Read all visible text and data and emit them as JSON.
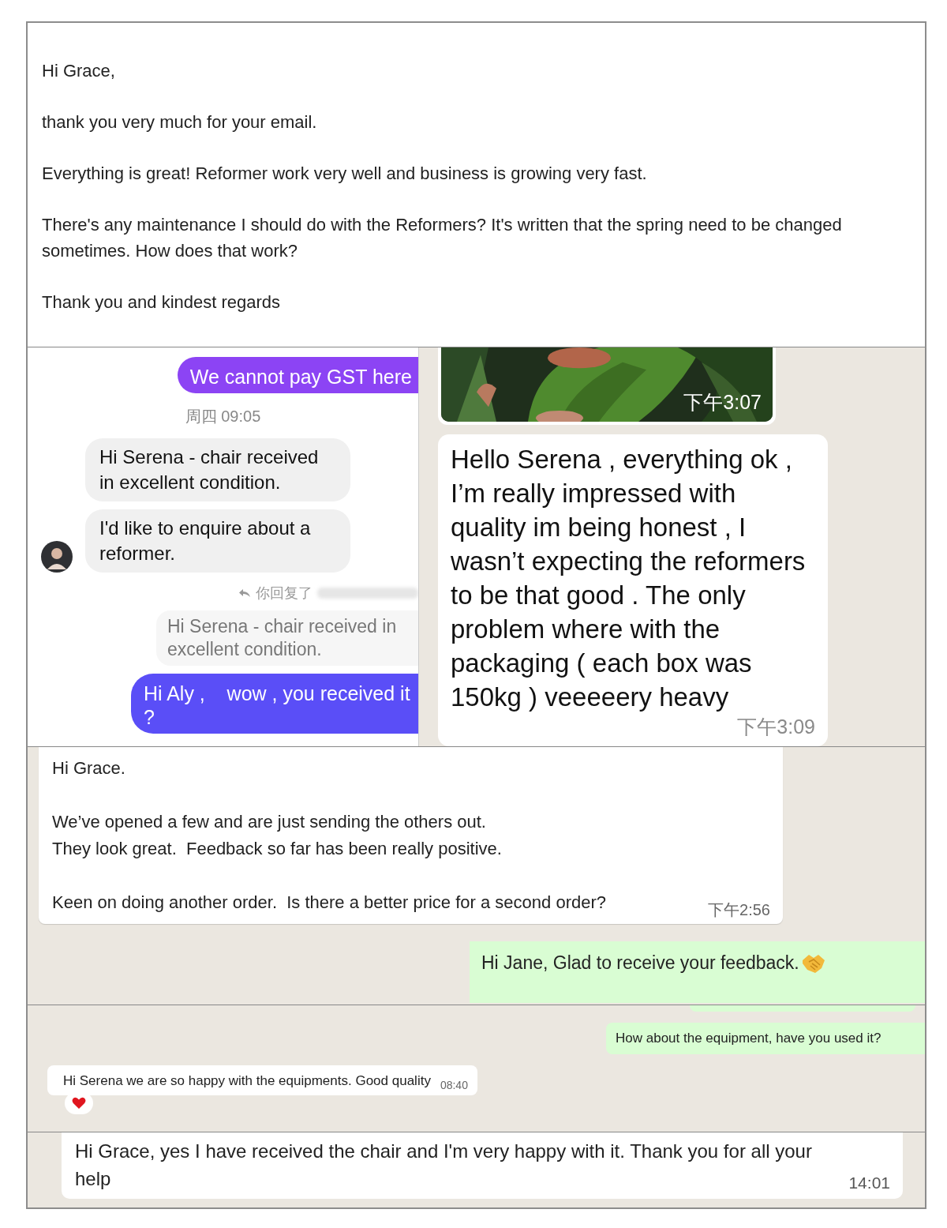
{
  "email": {
    "paragraphs": [
      [
        "Hi Grace,"
      ],
      [
        "thank you very much for your email."
      ],
      [
        "Everything is great! Reformer work very well and business is growing very fast."
      ],
      [
        "There's any maintenance I should do with the Reformers? It's written that the spring need to be changed sometimes. How does that work?"
      ],
      [
        "Thank you and kindest regards"
      ]
    ]
  },
  "messenger": {
    "items": [
      {
        "kind": "sent",
        "text": "We cannot pay GST here",
        "color": "#8c44f4"
      },
      {
        "kind": "time",
        "text": "周四 09:05"
      },
      {
        "kind": "received",
        "text": "Hi Serena - chair received in excellent condition.",
        "avatar": false
      },
      {
        "kind": "received",
        "text": "I'd like to enquire about a reformer.",
        "avatar": true
      },
      {
        "kind": "reply",
        "text": "你回复了"
      },
      {
        "kind": "quote",
        "text": "Hi Serena - chair received in excellent condition."
      },
      {
        "kind": "sent",
        "text": "Hi Aly ,    wow , you received it ?",
        "color": "#5a4ef7"
      }
    ]
  },
  "whatsapp_top": {
    "photo": {
      "kind": "picture",
      "time": "下午3:07"
    },
    "message": {
      "text": "Hello Serena , everything ok , I’m really impressed with quality im being honest , I wasn’t expecting the reformers to be that good . The only problem where with the packaging ( each box was 150kg ) veeeeery heavy",
      "time": "下午3:09"
    }
  },
  "whatsapp_mid": {
    "messages": [
      {
        "kind": "received",
        "paras": [
          [
            "Hi Grace."
          ],
          [
            "We’ve opened a few and are just sending the others out.",
            "They look great.  Feedback so far has been really positive."
          ],
          [
            "Keen on doing another order.  Is there a better price for a second order?"
          ]
        ],
        "time": "下午2:56"
      },
      {
        "kind": "sent",
        "lines": [
          "Hi Jane, Glad to receive your feedback."
        ]
      }
    ]
  },
  "whatsapp_low": {
    "messages": [
      {
        "kind": "partial"
      },
      {
        "kind": "sent",
        "text": "How about the equipment, have you used it?"
      },
      {
        "kind": "received",
        "text": "Hi Serena we are so happy with the equipments. Good quality",
        "time": "08:40",
        "reacted": true
      }
    ]
  },
  "whatsapp_bottom": {
    "message": {
      "text": "Hi Grace, yes I have received the chair and I'm very happy with it. Thank you for all your help",
      "time": "14:01"
    }
  }
}
